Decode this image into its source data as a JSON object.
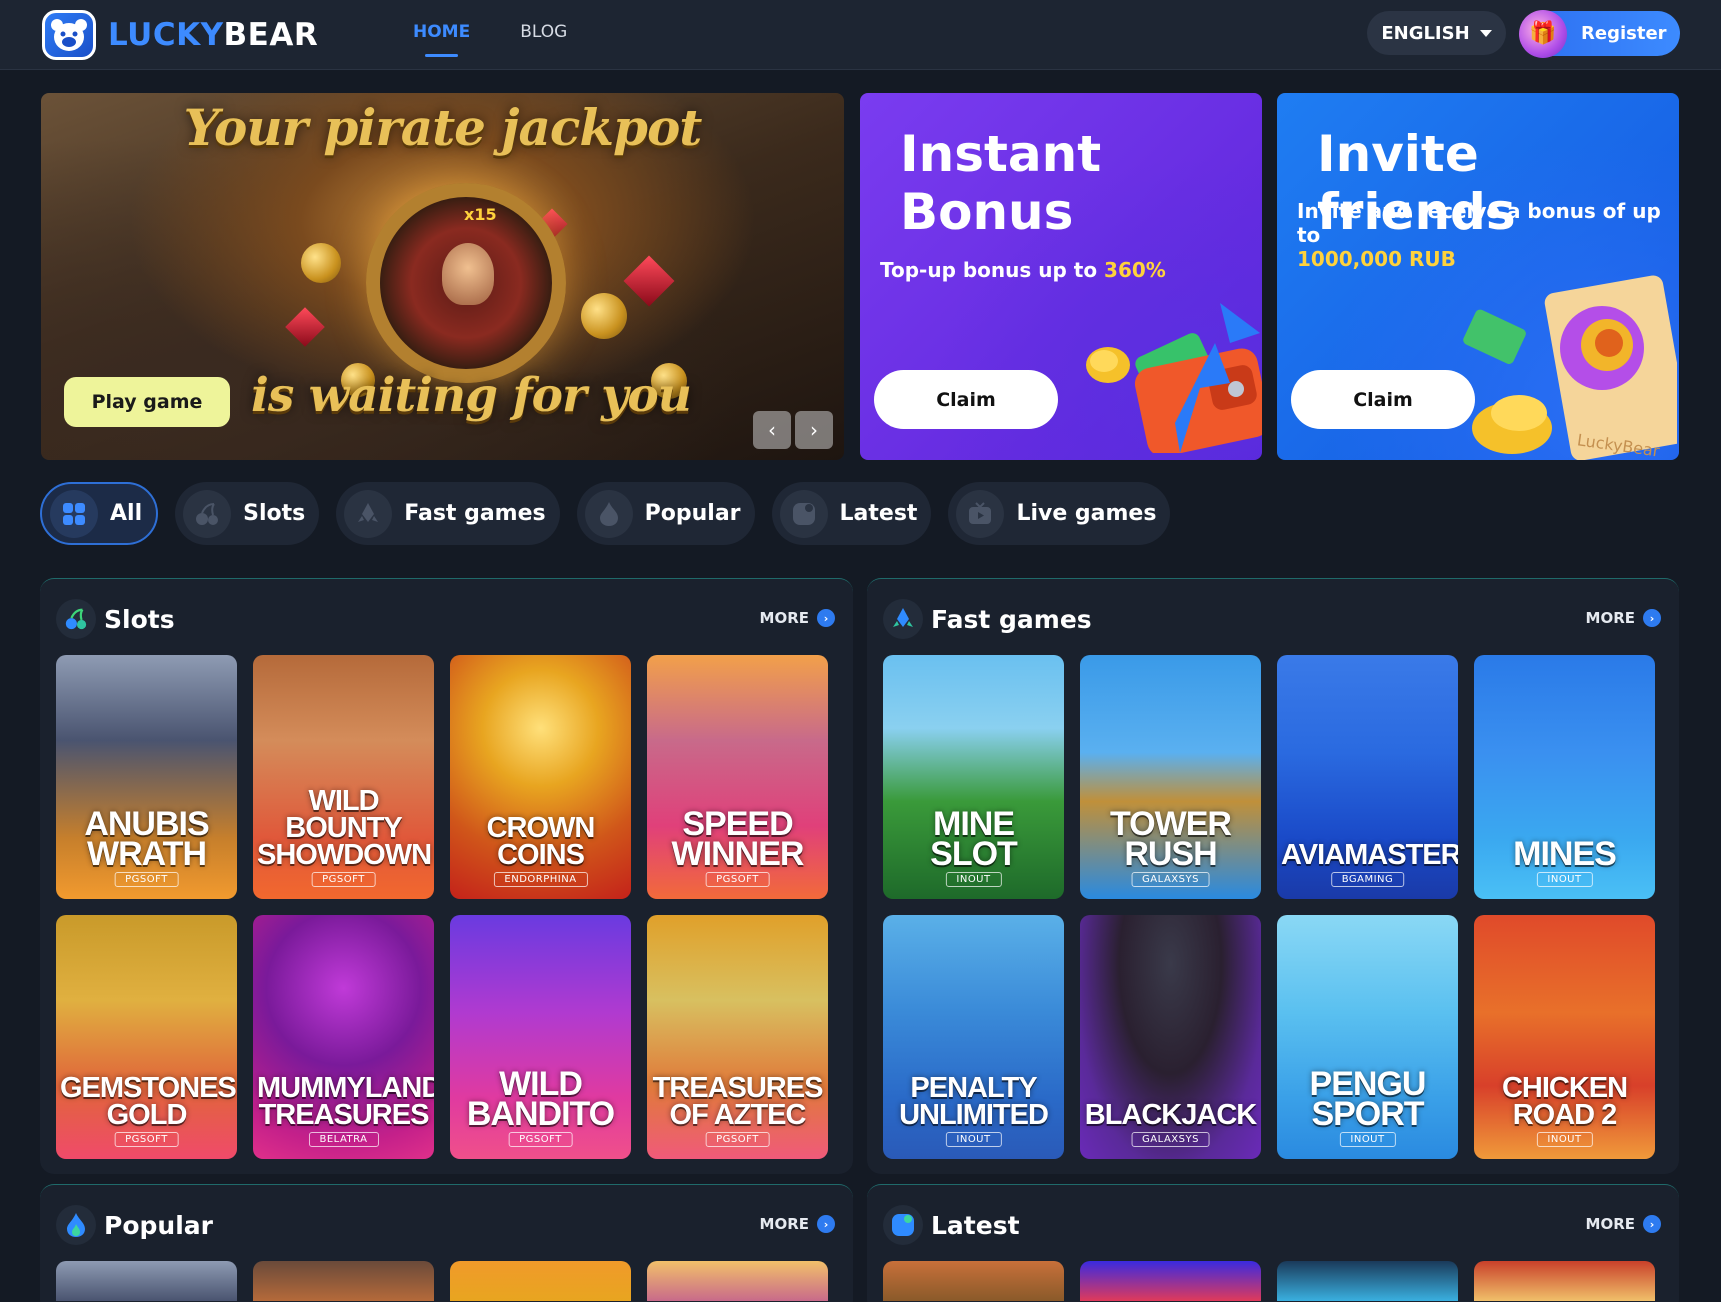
{
  "header": {
    "logo_lucky": "LUCKY",
    "logo_bear": "BEAR",
    "nav": [
      {
        "label": "HOME",
        "active": true
      },
      {
        "label": "BLOG",
        "active": false
      }
    ],
    "language": "ENGLISH",
    "register_label": "Register"
  },
  "banners": {
    "main": {
      "title": "Your pirate jackpot",
      "subtitle": "is waiting for you",
      "wheel_label": "x15",
      "play_label": "Play game",
      "prev_icon": "‹",
      "next_icon": "›"
    },
    "bonus": {
      "title_line1": "Instant",
      "title_line2": "Bonus",
      "subtitle_prefix": "Top-up bonus up to ",
      "subtitle_accent": "360%",
      "claim_label": "Claim"
    },
    "invite": {
      "title": "Invite friends",
      "subtitle_prefix": "Invite and receive a bonus of up to",
      "subtitle_accent": "1000,000 RUB",
      "claim_label": "Claim",
      "watermark": "LuckyBear"
    }
  },
  "tabs": [
    {
      "label": "All",
      "icon": "grid-icon",
      "active": true
    },
    {
      "label": "Slots",
      "icon": "cherries-icon",
      "active": false
    },
    {
      "label": "Fast games",
      "icon": "rocket-icon",
      "active": false
    },
    {
      "label": "Popular",
      "icon": "flame-icon",
      "active": false
    },
    {
      "label": "Latest",
      "icon": "clock-icon",
      "active": false
    },
    {
      "label": "Live games",
      "icon": "tv-icon",
      "active": false
    }
  ],
  "sections": {
    "slots": {
      "title": "Slots",
      "more_label": "MORE",
      "games": [
        {
          "name": "ANUBIS WRATH",
          "provider": "PGSOFT"
        },
        {
          "name": "WILD BOUNTY SHOWDOWN",
          "provider": "PGSOFT"
        },
        {
          "name": "CROWN COINS",
          "provider": "ENDORPHINA"
        },
        {
          "name": "SPEED WINNER",
          "provider": "PGSOFT"
        },
        {
          "name": "GEMSTONES GOLD",
          "provider": "PGSOFT"
        },
        {
          "name": "MUMMYLAND TREASURES",
          "provider": "BELATRA"
        },
        {
          "name": "WILD BANDITO",
          "provider": "PGSOFT"
        },
        {
          "name": "TREASURES OF AZTEC",
          "provider": "PGSOFT"
        }
      ]
    },
    "fast_games": {
      "title": "Fast games",
      "more_label": "MORE",
      "games": [
        {
          "name": "MINE SLOT",
          "provider": "INOUT"
        },
        {
          "name": "TOWER RUSH",
          "provider": "GALAXSYS"
        },
        {
          "name": "AVIAMASTERS",
          "provider": "BGAMING"
        },
        {
          "name": "MINES",
          "provider": "INOUT"
        },
        {
          "name": "PENALTY UNLIMITED",
          "provider": "INOUT"
        },
        {
          "name": "BLACKJACK",
          "provider": "GALAXSYS"
        },
        {
          "name": "PENGU SPORT",
          "provider": "INOUT"
        },
        {
          "name": "CHICKEN ROAD 2",
          "provider": "INOUT"
        }
      ]
    },
    "popular": {
      "title": "Popular",
      "more_label": "MORE"
    },
    "latest": {
      "title": "Latest",
      "more_label": "MORE"
    }
  },
  "colors": {
    "background": "#141a24",
    "header": "#1d2532",
    "accent_blue": "#3d8bff",
    "bonus_purple": "#6a2fe8",
    "invite_blue": "#1a6aeb",
    "play_button": "#eef49a",
    "accent_yellow": "#ffd23c"
  }
}
